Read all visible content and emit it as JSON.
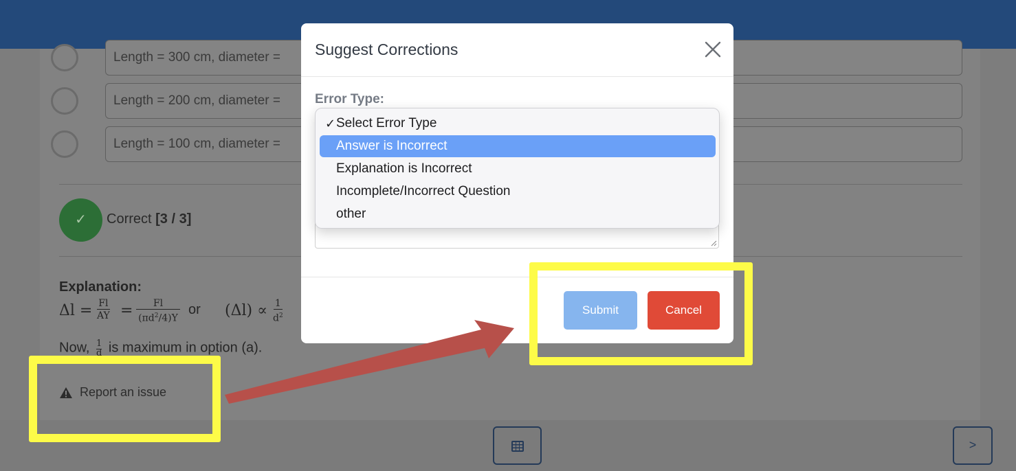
{
  "options": [
    {
      "text": "Length = 300 cm, diameter ="
    },
    {
      "text": "Length = 200 cm, diameter ="
    },
    {
      "text": "Length = 100 cm, diameter ="
    }
  ],
  "result": {
    "icon": "check-icon",
    "label": "Correct",
    "score": "[3 / 3]"
  },
  "explanation": {
    "title": "Explanation:",
    "formula": {
      "lhs": "Δl =",
      "f1_num": "Fl",
      "f1_den": "AY",
      "eq": "=",
      "f2_num": "Fl",
      "f2_den_a": "πd",
      "f2_den_b": "4",
      "f2_den_c": "Y",
      "or": "or",
      "rhs": "(Δl) ∝",
      "f3_num": "1",
      "f3_den": "d"
    },
    "now_prefix": "Now,",
    "now_frac_num": "1",
    "now_frac_den": "d",
    "now_suffix": "is maximum in option (a)."
  },
  "report": {
    "icon": "warning-icon",
    "label": "Report an issue"
  },
  "footer": {
    "grid_icon": "grid-icon",
    "next_label": ">"
  },
  "modal": {
    "title": "Suggest Corrections",
    "close_icon": "close-icon",
    "error_type_label": "Error Type:",
    "dropdown": {
      "options": [
        {
          "label": "Select Error Type",
          "checked": true
        },
        {
          "label": "Answer is Incorrect",
          "highlighted": true
        },
        {
          "label": "Explanation is Incorrect"
        },
        {
          "label": "Incomplete/Incorrect Question"
        },
        {
          "label": "other"
        }
      ]
    },
    "submit_label": "Submit",
    "cancel_label": "Cancel"
  },
  "colors": {
    "topbar": "#23497a",
    "highlight": "#fdfb48",
    "arrow": "#b7504a",
    "submit": "#86b5ee",
    "cancel": "#e04a37",
    "dropdown_selected": "#6aa0f7"
  }
}
